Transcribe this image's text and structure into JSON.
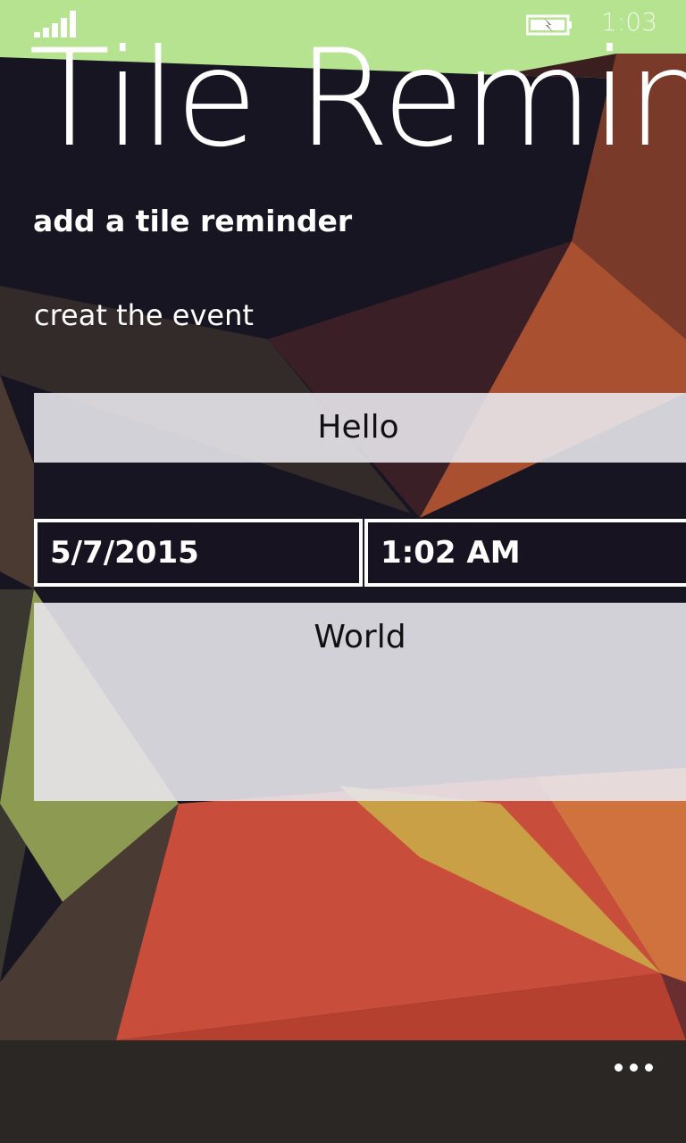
{
  "status_bar": {
    "time": "1:03",
    "signal_icon": "signal-bars-icon",
    "battery_icon": "battery-charging-icon"
  },
  "header": {
    "app_title": "Tile Reminder",
    "page_subtitle": "add a tile reminder"
  },
  "form": {
    "section_label": "creat the event",
    "title_value": "Hello",
    "date_value": "5/7/2015",
    "time_value": "1:02 AM",
    "message_value": "World"
  },
  "app_bar": {
    "more_icon": "ellipsis-icon"
  },
  "colors": {
    "text": "#ffffff",
    "input_background": "#e8e6ec",
    "app_bar_background": "#2b2725"
  }
}
